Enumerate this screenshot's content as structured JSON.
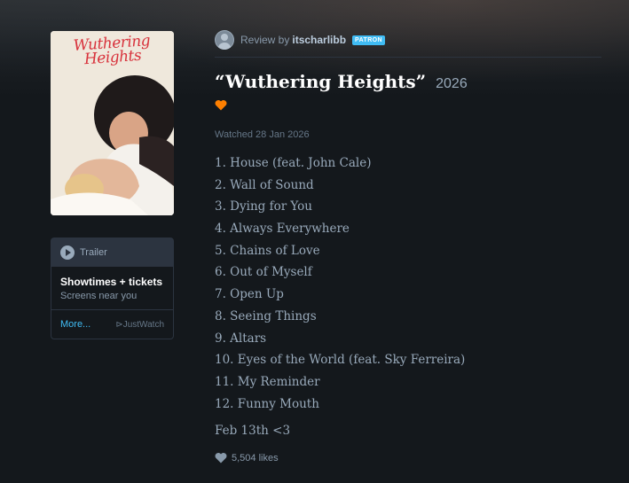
{
  "poster": {
    "title_line1": "Wuthering",
    "title_line2": "Heights",
    "accent_color": "#d8323c"
  },
  "watch_panel": {
    "trailer_label": "Trailer",
    "showtimes_title": "Showtimes + tickets",
    "showtimes_sub": "Screens near you",
    "more_label": "More...",
    "provider_label": "⊳JustWatch"
  },
  "review": {
    "review_by_label": "Review by",
    "username": "itscharlibb",
    "badge": "PATRON",
    "film_title": "“Wuthering Heights”",
    "film_year": "2026",
    "liked": true,
    "watched_date": "Watched 28 Jan 2026",
    "tracks": [
      "1. House (feat. John Cale)",
      "2. Wall of Sound",
      "3. Dying for You",
      "4. Always Everywhere",
      "5. Chains of Love",
      "6. Out of Myself",
      "7. Open Up",
      "8. Seeing Things",
      "9. Altars",
      "10. Eyes of the World (feat. Sky Ferreira)",
      "11. My Reminder",
      "12. Funny Mouth"
    ],
    "closing_line": "Feb 13th <3",
    "likes": "5,504 likes"
  },
  "colors": {
    "background": "#14181c",
    "heart": "#ff8000",
    "link": "#40bcf4"
  }
}
